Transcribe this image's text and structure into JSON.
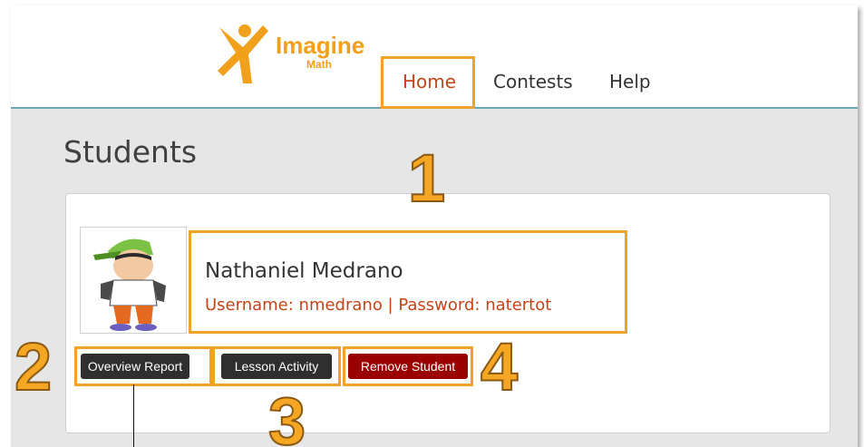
{
  "header": {
    "logo_text": "Imagine",
    "logo_sub": "Math",
    "nav": [
      {
        "label": "Home"
      },
      {
        "label": "Contests"
      },
      {
        "label": "Help"
      }
    ]
  },
  "page": {
    "title": "Students"
  },
  "student": {
    "name": "Nathaniel Medrano",
    "credentials": "Username: nmedrano | Password: natertot"
  },
  "actions": {
    "overview_label": "Overview Report",
    "lesson_label": "Lesson Activity",
    "remove_label": "Remove Student"
  },
  "annotations": [
    "1",
    "2",
    "3",
    "4"
  ],
  "colors": {
    "accent_orange": "#c4441a",
    "highlight": "#f0a12a",
    "button_dark": "#2f2f2f",
    "button_red": "#9b0000",
    "header_border": "#6ea7b3"
  }
}
